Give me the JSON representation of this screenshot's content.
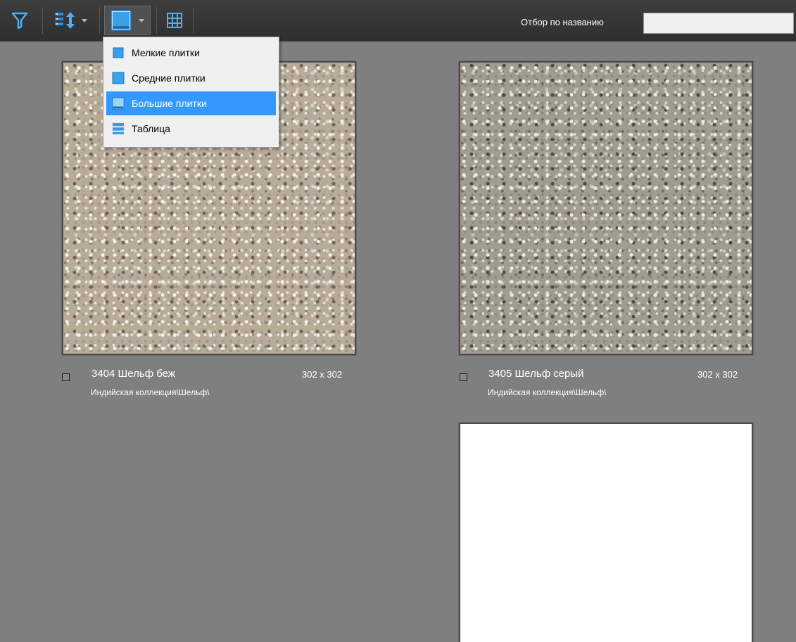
{
  "toolbar": {
    "filter_label": "Отбор по названию",
    "filter_value": "",
    "filter_icon": "filter-funnel-icon",
    "sort_icon": "sort-order-icon",
    "view_icon": "large-tiles-view-icon",
    "grid_icon": "grid-icon"
  },
  "view_menu": {
    "items": [
      {
        "label": "Мелкие плитки",
        "icon": "small-tiles-icon"
      },
      {
        "label": "Средние плитки",
        "icon": "medium-tiles-icon"
      },
      {
        "label": "Большие плитки",
        "icon": "large-tiles-icon",
        "selected": true
      },
      {
        "label": "Таблица",
        "icon": "table-view-icon"
      }
    ]
  },
  "tiles": [
    {
      "name": "3404 Шельф беж",
      "size": "302 x 302",
      "path": "Индийская коллекция\\Шельф\\",
      "checked": false
    },
    {
      "name": "3405 Шельф серый",
      "size": "302 x 302",
      "path": "Индийская коллекция\\Шельф\\",
      "checked": false
    }
  ],
  "colors": {
    "accent": "#3399ff",
    "toolbar_bg": "#363636",
    "workspace_bg": "#7f7f7f",
    "icon_blue": "#3aa0e8"
  }
}
